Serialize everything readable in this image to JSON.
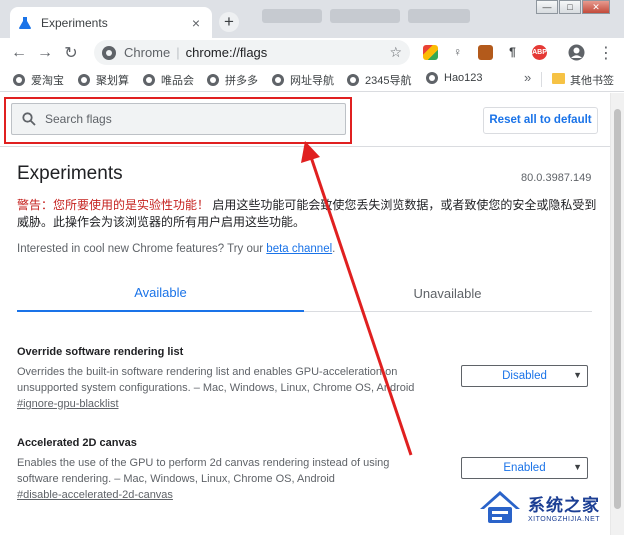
{
  "browser": {
    "tab_title": "Experiments",
    "tab_close_icon": "×",
    "new_tab_icon": "+",
    "window_controls": {
      "minimize": "—",
      "maximize": "□",
      "close": "✕"
    }
  },
  "toolbar": {
    "back_icon": "←",
    "forward_icon": "→",
    "reload_icon": "↻",
    "omnibox_origin": "Chrome",
    "omnibox_separator": "|",
    "omnibox_url": "chrome://flags",
    "star_icon": "☆",
    "extension_abp": "ABP",
    "menu_icon": "⋮"
  },
  "bookmarks": {
    "items": [
      {
        "label": "爱淘宝"
      },
      {
        "label": "聚划算"
      },
      {
        "label": "唯品会"
      },
      {
        "label": "拼多多"
      },
      {
        "label": "网址导航"
      },
      {
        "label": "2345导航"
      },
      {
        "label": "Hao123"
      }
    ],
    "more_icon": "»",
    "other_bookmarks": "其他书签"
  },
  "header": {
    "search_placeholder": "Search flags",
    "reset_button": "Reset all to default"
  },
  "page": {
    "title": "Experiments",
    "version": "80.0.3987.149",
    "warning_red": "警告：您所要使用的是实验性功能！",
    "warning_text": "启用这些功能可能会致使您丢失浏览数据，或者致使您的安全或隐私受到威胁。此操作会为该浏览器的所有用户启用这些功能。",
    "intro_prefix": "Interested in cool new Chrome features? Try our ",
    "intro_link": "beta channel",
    "intro_suffix": ".",
    "tabs": {
      "available": "Available",
      "unavailable": "Unavailable"
    },
    "flags": [
      {
        "name": "Override software rendering list",
        "description": "Overrides the built-in software rendering list and enables GPU-acceleration on unsupported system configurations. – Mac, Windows, Linux, Chrome OS, Android",
        "anchor": "#ignore-gpu-blacklist",
        "value": "Disabled"
      },
      {
        "name": "Accelerated 2D canvas",
        "description": "Enables the use of the GPU to perform 2d canvas rendering instead of using software rendering. – Mac, Windows, Linux, Chrome OS, Android",
        "anchor": "#disable-accelerated-2d-canvas",
        "value": "Enabled"
      }
    ],
    "select_caret": "▼"
  },
  "watermark": {
    "name_cn": "系统之家",
    "name_en": "XITONGZHIJIA.NET"
  },
  "colors": {
    "accent": "#1a73e8",
    "warning_red": "#c5221f",
    "annotation_red": "#e02020"
  }
}
